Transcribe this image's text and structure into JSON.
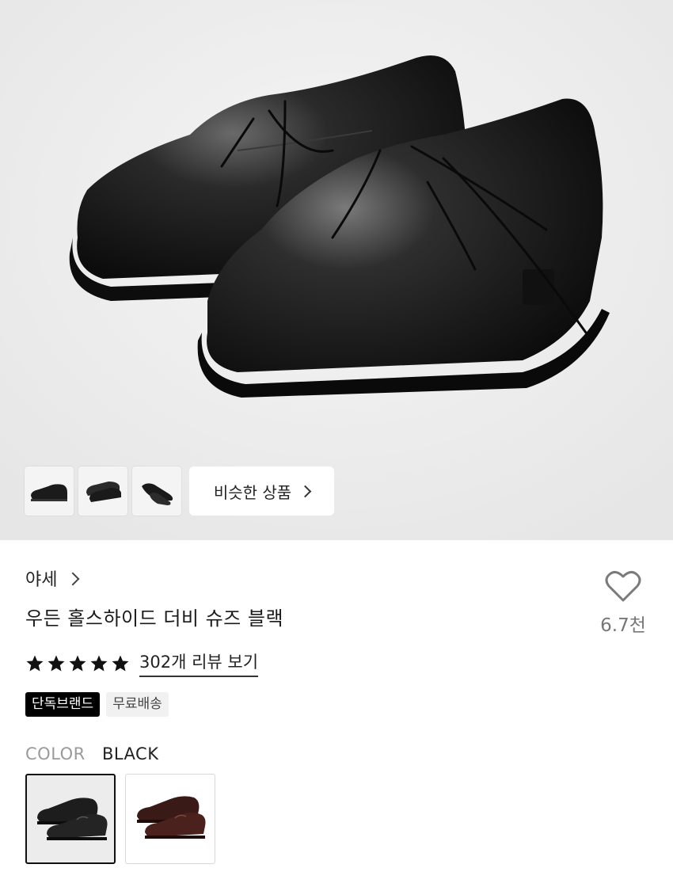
{
  "gallery": {
    "similar_label": "비슷한 상품",
    "thumbnails": [
      "thumbnail-1",
      "thumbnail-2",
      "thumbnail-3"
    ]
  },
  "product": {
    "brand": "야세",
    "title": "우든 홀스하이드 더비 슈즈 블랙",
    "like_count": "6.7천",
    "rating_stars": 5,
    "review_link": "302개 리뷰 보기",
    "badges": [
      "단독브랜드",
      "무료배송"
    ],
    "color_label": "COLOR",
    "color_value": "BLACK",
    "color_options": [
      {
        "name": "black",
        "color": "#1d1d1d",
        "selected": true
      },
      {
        "name": "brown",
        "color": "#3a1a16",
        "selected": false
      }
    ]
  },
  "colors": {
    "hero_background": "#ebebeb",
    "shoe_black": "#151515",
    "shoe_brown": "#3a1a16",
    "badge_dark": "#000000",
    "badge_light": "#f1f1f1"
  }
}
